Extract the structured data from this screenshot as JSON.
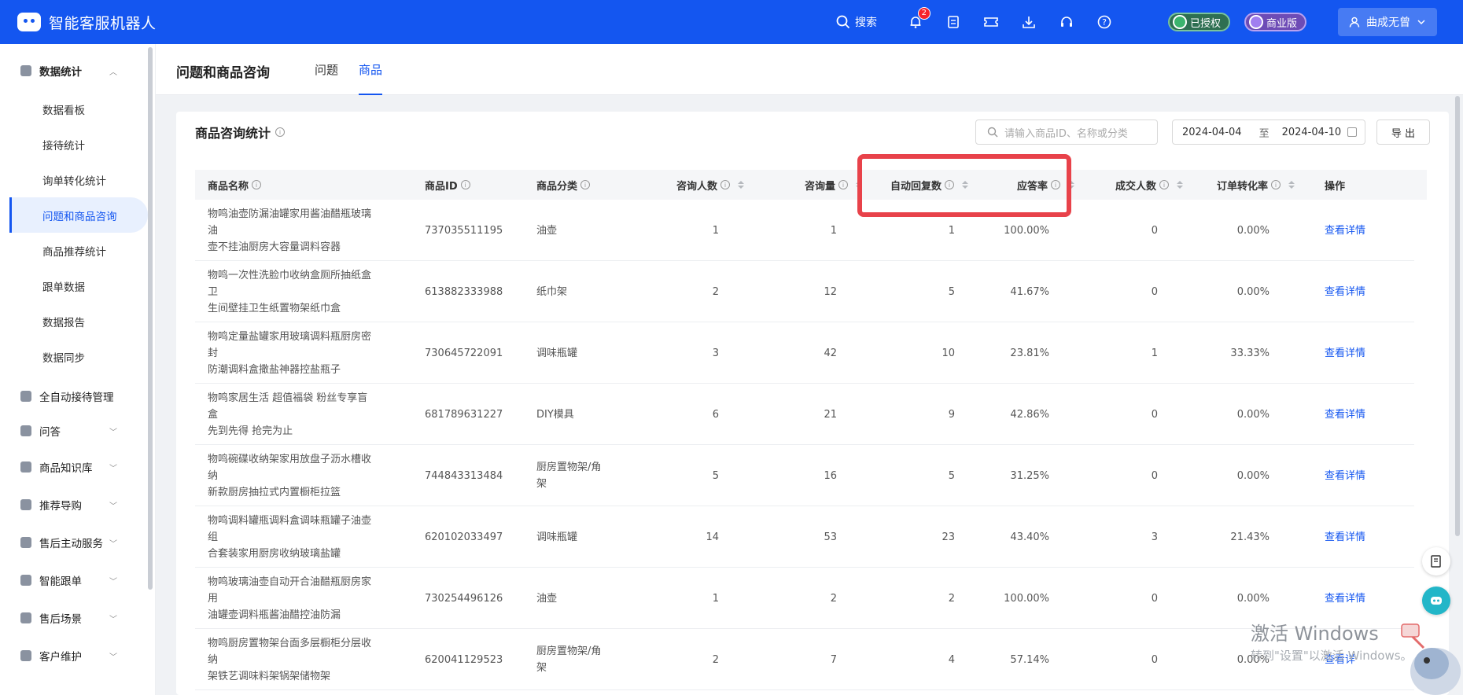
{
  "app": {
    "title": "智能客服机器人"
  },
  "topbar": {
    "search_label": "搜索",
    "notification_count": "2",
    "auth_label": "已授权",
    "edition_label": "商业版",
    "user_name": "曲成无曾"
  },
  "sidebar": {
    "groups": [
      {
        "label": "数据统计",
        "expanded": true
      },
      {
        "label": "全自动接待管理"
      },
      {
        "label": "问答"
      },
      {
        "label": "商品知识库"
      },
      {
        "label": "推荐导购"
      },
      {
        "label": "售后主动服务"
      },
      {
        "label": "智能跟单"
      },
      {
        "label": "售后场景"
      },
      {
        "label": "客户维护"
      }
    ],
    "sub_items": [
      {
        "label": "数据看板"
      },
      {
        "label": "接待统计"
      },
      {
        "label": "询单转化统计"
      },
      {
        "label": "问题和商品咨询",
        "active": true
      },
      {
        "label": "商品推荐统计"
      },
      {
        "label": "跟单数据"
      },
      {
        "label": "数据报告"
      },
      {
        "label": "数据同步"
      }
    ]
  },
  "page": {
    "title": "问题和商品咨询",
    "tabs": [
      {
        "label": "问题"
      },
      {
        "label": "商品",
        "active": true
      }
    ]
  },
  "card": {
    "title": "商品咨询统计",
    "search_placeholder": "请输入商品ID、名称或分类",
    "date_start": "2024-04-04",
    "date_sep": "至",
    "date_end": "2024-04-10",
    "export_label": "导 出"
  },
  "table": {
    "columns": [
      {
        "label": "商品名称"
      },
      {
        "label": "商品ID"
      },
      {
        "label": "商品分类"
      },
      {
        "label": "咨询人数"
      },
      {
        "label": "咨询量"
      },
      {
        "label": "自动回复数"
      },
      {
        "label": "应答率"
      },
      {
        "label": "成交人数"
      },
      {
        "label": "订单转化率"
      },
      {
        "label": "操作"
      }
    ],
    "rows": [
      {
        "name1": "物鸣油壶防漏油罐家用酱油醋瓶玻璃油",
        "name2": "壶不挂油厨房大容量调料容器",
        "id": "737035511195",
        "cat1": "油壶",
        "cat2": "",
        "consult_users": "1",
        "consults": "1",
        "auto_replies": "1",
        "answer_rate": "100.00%",
        "deals": "0",
        "conv_rate": "0.00%",
        "action": "查看详情"
      },
      {
        "name1": "物鸣一次性洗脸巾收纳盒厕所抽纸盒卫",
        "name2": "生间壁挂卫生纸置物架纸巾盒",
        "id": "613882333988",
        "cat1": "纸巾架",
        "cat2": "",
        "consult_users": "2",
        "consults": "12",
        "auto_replies": "5",
        "answer_rate": "41.67%",
        "deals": "0",
        "conv_rate": "0.00%",
        "action": "查看详情"
      },
      {
        "name1": "物鸣定量盐罐家用玻璃调料瓶厨房密封",
        "name2": "防潮调料盒撒盐神器控盐瓶子",
        "id": "730645722091",
        "cat1": "调味瓶罐",
        "cat2": "",
        "consult_users": "3",
        "consults": "42",
        "auto_replies": "10",
        "answer_rate": "23.81%",
        "deals": "1",
        "conv_rate": "33.33%",
        "action": "查看详情"
      },
      {
        "name1": "物鸣家居生活 超值福袋 粉丝专享盲盒",
        "name2": "先到先得 抢完为止",
        "id": "681789631227",
        "cat1": "DIY模具",
        "cat2": "",
        "consult_users": "6",
        "consults": "21",
        "auto_replies": "9",
        "answer_rate": "42.86%",
        "deals": "0",
        "conv_rate": "0.00%",
        "action": "查看详情"
      },
      {
        "name1": "物鸣碗碟收纳架家用放盘子沥水槽收纳",
        "name2": "新款厨房抽拉式内置橱柜拉篮",
        "id": "744843313484",
        "cat1": "厨房置物架/角",
        "cat2": "架",
        "consult_users": "5",
        "consults": "16",
        "auto_replies": "5",
        "answer_rate": "31.25%",
        "deals": "0",
        "conv_rate": "0.00%",
        "action": "查看详情"
      },
      {
        "name1": "物鸣调料罐瓶调料盒调味瓶罐子油壶组",
        "name2": "合套装家用厨房收纳玻璃盐罐",
        "id": "620102033497",
        "cat1": "调味瓶罐",
        "cat2": "",
        "consult_users": "14",
        "consults": "53",
        "auto_replies": "23",
        "answer_rate": "43.40%",
        "deals": "3",
        "conv_rate": "21.43%",
        "action": "查看详情"
      },
      {
        "name1": "物鸣玻璃油壶自动开合油醋瓶厨房家用",
        "name2": "油罐壶调料瓶酱油醋控油防漏",
        "id": "730254496126",
        "cat1": "油壶",
        "cat2": "",
        "consult_users": "1",
        "consults": "2",
        "auto_replies": "2",
        "answer_rate": "100.00%",
        "deals": "0",
        "conv_rate": "0.00%",
        "action": "查看详情"
      },
      {
        "name1": "物鸣厨房置物架台面多层橱柜分层收纳",
        "name2": "架铁艺调味料架锅架储物架",
        "id": "620041129523",
        "cat1": "厨房置物架/角",
        "cat2": "架",
        "consult_users": "2",
        "consults": "7",
        "auto_replies": "4",
        "answer_rate": "57.14%",
        "deals": "0",
        "conv_rate": "0.00%",
        "action": "查看详"
      }
    ]
  },
  "watermark": {
    "line1": "激活 Windows",
    "line2": "转到\"设置\"以激活 Windows。"
  },
  "colors": {
    "primary": "#1456f0",
    "highlight": "#e8424a",
    "header_bg": "#f5f6f8"
  }
}
